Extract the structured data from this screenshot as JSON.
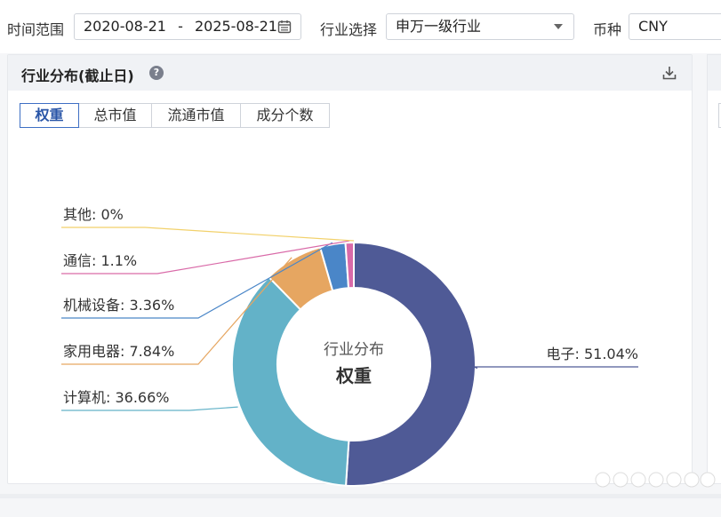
{
  "filters": {
    "time_range_label": "时间范围",
    "start_date": "2020-08-21",
    "date_separator": "-",
    "end_date": "2025-08-21",
    "industry_label": "行业选择",
    "industry_value": "申万一级行业",
    "currency_label": "币种",
    "currency_value": "CNY"
  },
  "panel": {
    "title": "行业分布(截止日)",
    "help_glyph": "?",
    "tabs": [
      {
        "label": "权重",
        "active": true
      },
      {
        "label": "总市值",
        "active": false
      },
      {
        "label": "流通市值",
        "active": false
      },
      {
        "label": "成分个数",
        "active": false
      }
    ]
  },
  "chart_data": {
    "type": "pie",
    "donut": true,
    "center_title": "行业分布",
    "center_subtitle": "权重",
    "label_format": "name: value%",
    "slices": [
      {
        "name": "电子",
        "value": 51.04,
        "label": "电子: 51.04%",
        "color": "#4f5a96"
      },
      {
        "name": "计算机",
        "value": 36.66,
        "label": "计算机: 36.66%",
        "color": "#63b2c8"
      },
      {
        "name": "家用电器",
        "value": 7.84,
        "label": "家用电器: 7.84%",
        "color": "#e6a661"
      },
      {
        "name": "机械设备",
        "value": 3.36,
        "label": "机械设备: 3.36%",
        "color": "#4a86c8"
      },
      {
        "name": "通信",
        "value": 1.1,
        "label": "通信: 1.1%",
        "color": "#d96aa8"
      },
      {
        "name": "其他",
        "value": 0,
        "label": "其他: 0%",
        "color": "#f2d16b"
      }
    ]
  }
}
